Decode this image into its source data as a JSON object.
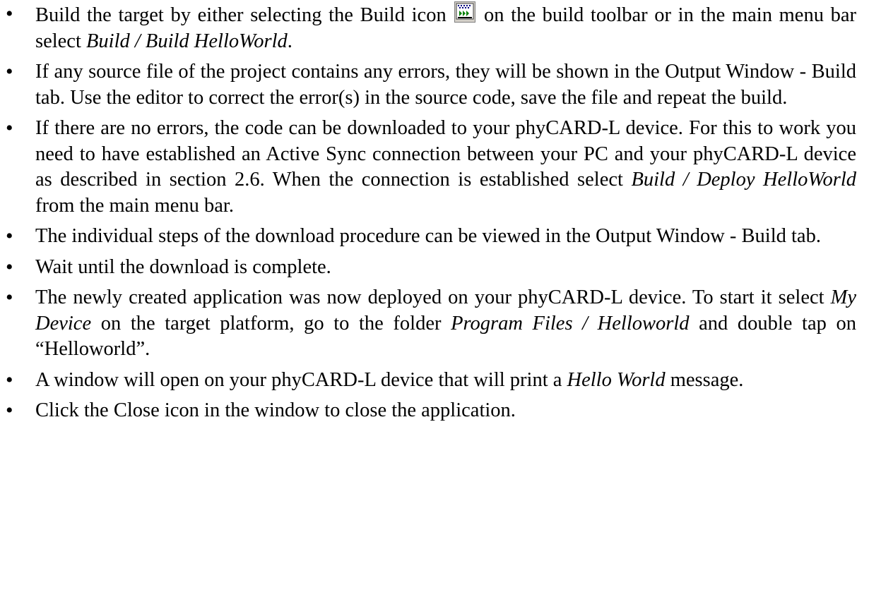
{
  "bullets": [
    {
      "parts": [
        "Build the target by either selecting the Build icon ",
        " on the build toolbar or in the main menu bar select ",
        "Build / Build HelloWorld",
        "."
      ],
      "icon": "build-icon"
    },
    {
      "text": "If any source file of the project contains any errors, they will be shown in the Output Window - Build tab. Use the editor to correct the error(s) in the source code, save the file and repeat the build."
    },
    {
      "parts": [
        "If there are no errors, the code can be downloaded to your phyCARD-L device. For this to work you need to have established an Active Sync connection between your PC and your phyCARD-L device as described in section 2.6. When the connection is established select ",
        "Build / Deploy HelloWorld",
        " from the main menu bar."
      ]
    },
    {
      "text": "The individual steps of the download procedure can be viewed in the Output Window - Build tab."
    },
    {
      "text": "Wait until the download is complete."
    },
    {
      "parts": [
        "The newly created application was now deployed on your phyCARD-L device. To start it select ",
        "My Device",
        " on the target platform, go to the folder ",
        "Program Files / Helloworld",
        " and double tap on “Helloworld”."
      ]
    },
    {
      "parts": [
        "A window will open on your phyCARD-L device that will print a ",
        "Hello World",
        " message."
      ]
    },
    {
      "text": "Click the Close icon in the window to close the application."
    }
  ]
}
